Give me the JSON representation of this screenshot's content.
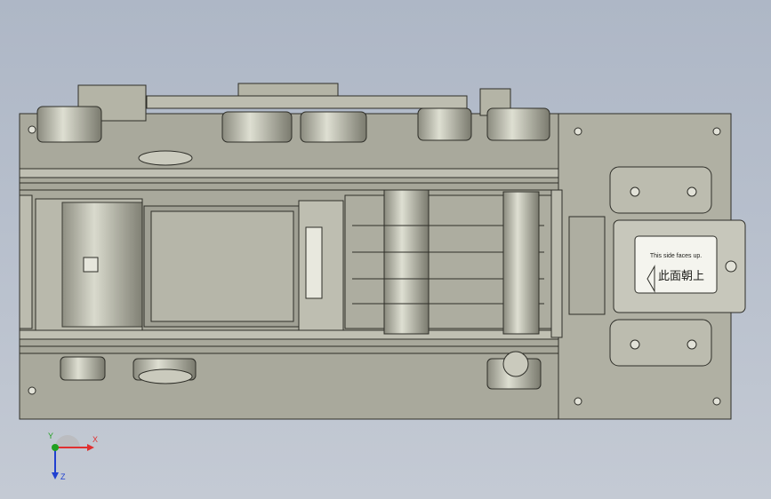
{
  "viewport": {
    "background_top": "#aeb7c6",
    "background_bottom": "#c4cad4",
    "model_fill": "#b4b4a6",
    "model_edge": "#2e2e28"
  },
  "model": {
    "label_plate": {
      "line1": "This side faces up.",
      "line2": "此面朝上"
    }
  },
  "triad": {
    "x_label": "X",
    "y_label": "Y",
    "z_label": "Z",
    "x_color": "#e03030",
    "y_color": "#20a020",
    "z_color": "#2040d0"
  }
}
